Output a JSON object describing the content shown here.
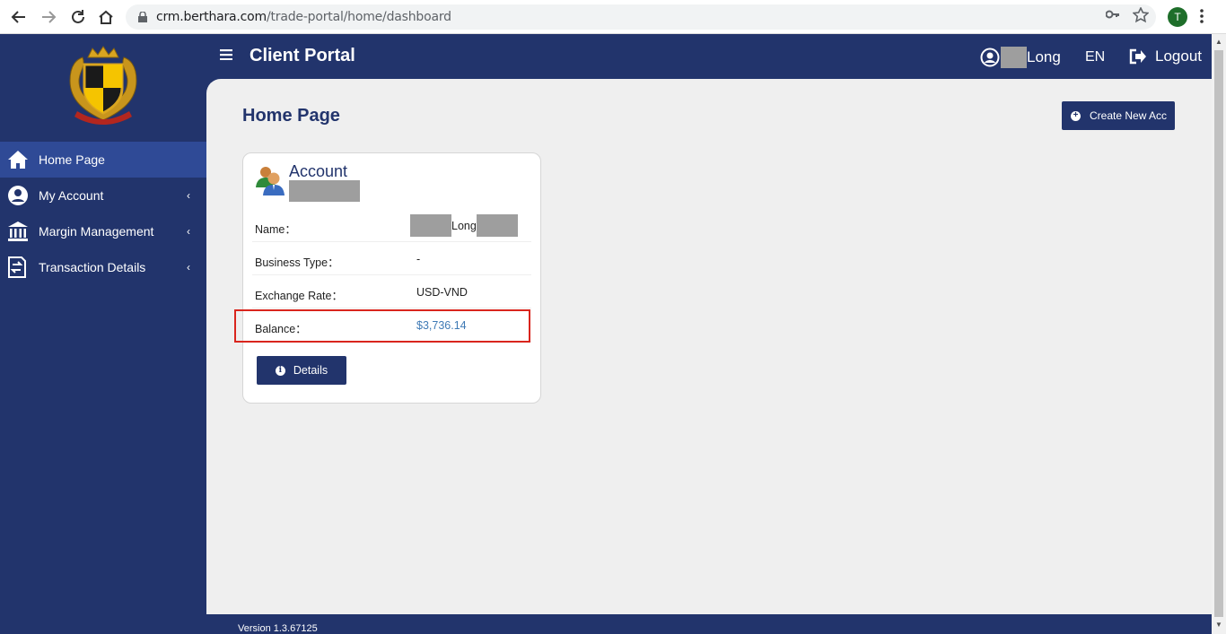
{
  "browser": {
    "url_host": "crm.berthara.com",
    "url_path": "/trade-portal/home/dashboard",
    "profile_initial": "T"
  },
  "sidebar": {
    "items": [
      {
        "label": "Home Page",
        "icon": "home-icon",
        "active": true
      },
      {
        "label": "My Account",
        "icon": "user-circle-icon",
        "chevron": "‹"
      },
      {
        "label": "Margin Management",
        "icon": "bank-icon",
        "chevron": "‹"
      },
      {
        "label": "Transaction Details",
        "icon": "transfer-icon",
        "chevron": "‹"
      }
    ]
  },
  "header": {
    "title": "Client Portal",
    "user_name": "Long",
    "language": "EN",
    "logout_label": "Logout"
  },
  "main": {
    "page_title": "Home Page",
    "create_button_label": "Create New Acc",
    "account_card": {
      "title": "Account",
      "rows": [
        {
          "label": "Name：",
          "value": "Long"
        },
        {
          "label": "Business Type：",
          "value": "-"
        },
        {
          "label": "Exchange Rate：",
          "value": "USD-VND"
        },
        {
          "label": "Balance：",
          "value": "$3,736.14"
        }
      ],
      "details_button_label": "Details"
    }
  },
  "footer": {
    "version": "Version 1.3.67125"
  },
  "colors": {
    "brand": "#22346c",
    "active_menu": "#2f4a96",
    "balance": "#3f7ab5",
    "highlight": "#d9251d"
  }
}
